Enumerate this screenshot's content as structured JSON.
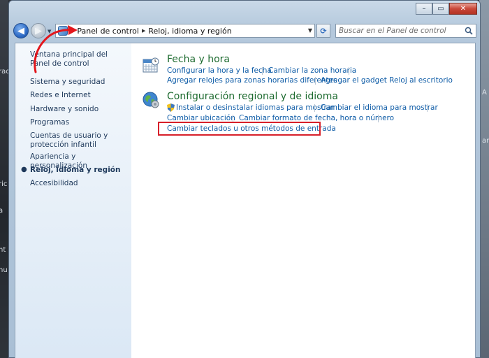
{
  "desktop": {
    "left_fragments": [
      "rac",
      "ric",
      "a",
      "nt",
      "nu"
    ],
    "right_fragments": [
      "A",
      "ar"
    ]
  },
  "window": {
    "controls": {
      "minimize": "–",
      "maximize": "▭",
      "close": "✕"
    }
  },
  "navbar": {
    "breadcrumb": [
      "Panel de control",
      "Reloj, idioma y región"
    ],
    "search_placeholder": "Buscar en el Panel de control"
  },
  "sidebar": {
    "items": [
      {
        "label": "Ventana principal del Panel de control",
        "current": false
      },
      {
        "label": "Sistema y seguridad",
        "current": false
      },
      {
        "label": "Redes e Internet",
        "current": false
      },
      {
        "label": "Hardware y sonido",
        "current": false
      },
      {
        "label": "Programas",
        "current": false
      },
      {
        "label": "Cuentas de usuario y protección infantil",
        "current": false
      },
      {
        "label": "Apariencia y personalización",
        "current": false
      },
      {
        "label": "Reloj, idioma y región",
        "current": true
      },
      {
        "label": "Accesibilidad",
        "current": false
      }
    ]
  },
  "sections": [
    {
      "title": "Fecha y hora",
      "icon": "calendar-clock-icon",
      "links": [
        "Configurar la hora y la fecha",
        "Cambiar la zona horaria",
        "Agregar relojes para zonas horarias diferentes",
        "Agregar el gadget Reloj al escritorio"
      ]
    },
    {
      "title": "Configuración regional y de idioma",
      "icon": "globe-icon",
      "links": [
        "Instalar o desinstalar idiomas para mostrar",
        "Cambiar el idioma para mostrar",
        "Cambiar ubicación",
        "Cambiar formato de fecha, hora o número",
        "Cambiar teclados u otros métodos de entrada"
      ]
    }
  ],
  "colors": {
    "link": "#0d5ba6",
    "section_title": "#1e6b30",
    "annotation": "#d7202a"
  }
}
